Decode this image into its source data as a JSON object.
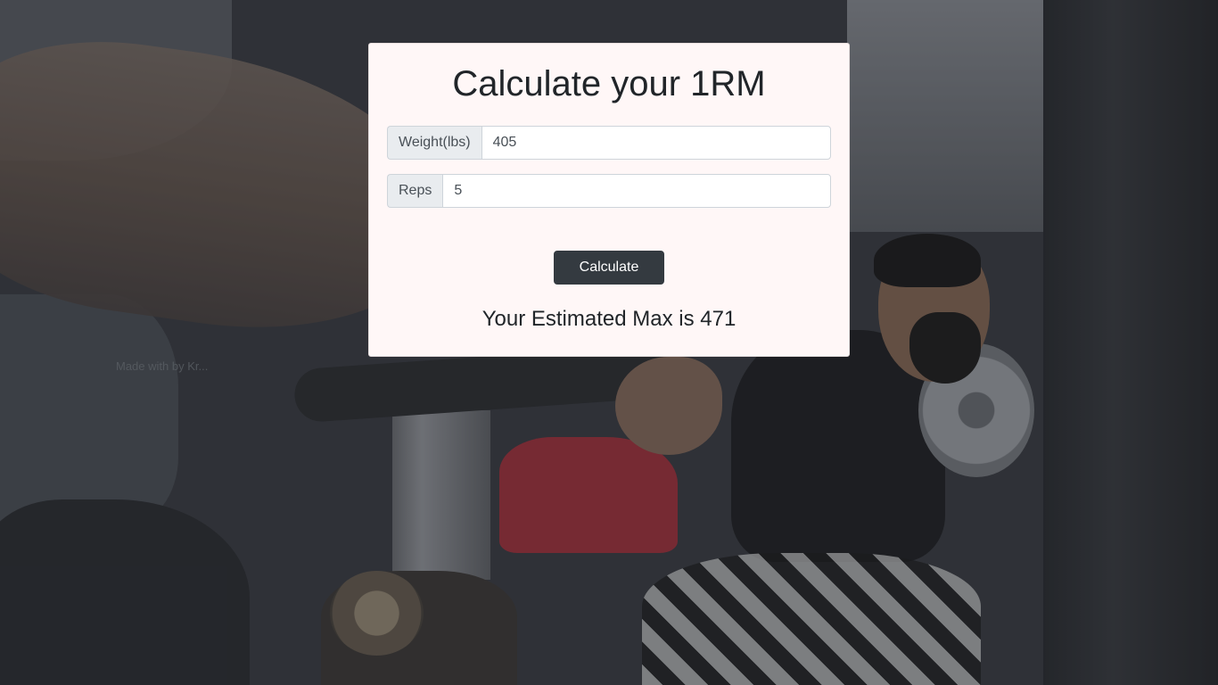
{
  "page": {
    "title": "Calculate your 1RM",
    "watermark": "Made with by Kr..."
  },
  "form": {
    "weight": {
      "label": "Weight(lbs)",
      "value": "405"
    },
    "reps": {
      "label": "Reps",
      "value": "5"
    },
    "submit_label": "Calculate"
  },
  "result": {
    "text": "Your Estimated Max is 471"
  },
  "colors": {
    "card_background": "#fff7f7",
    "button": "#343a40",
    "text": "#212529"
  }
}
